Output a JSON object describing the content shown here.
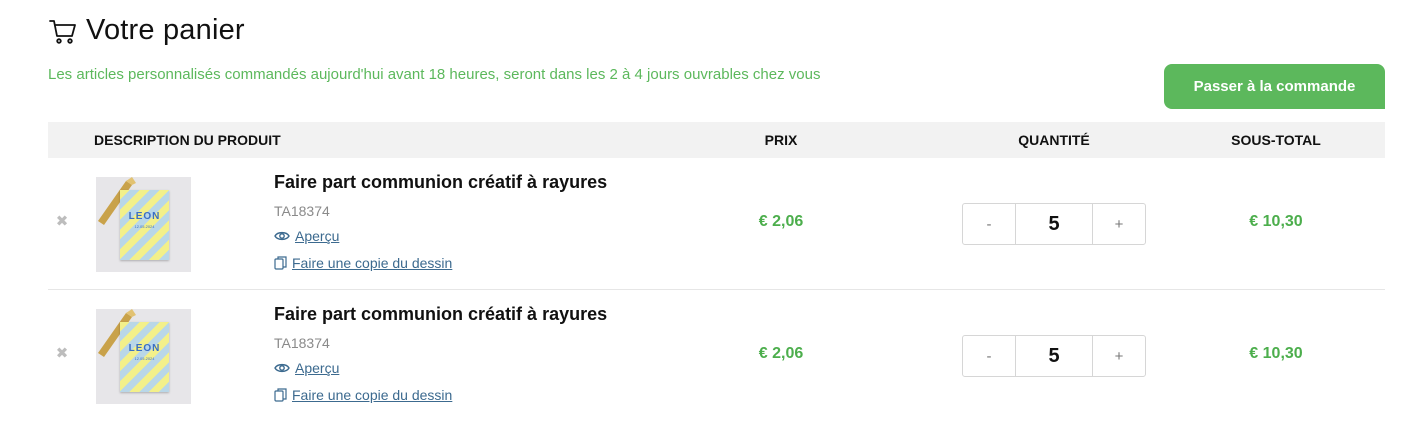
{
  "header": {
    "title": "Votre panier",
    "notice": "Les articles personnalisés commandés aujourd'hui avant 18 heures, seront dans les 2 à 4 jours ouvrables chez vous",
    "checkout_label": "Passer à la commande"
  },
  "table": {
    "columns": {
      "description": "DESCRIPTION DU PRODUIT",
      "price": "PRIX",
      "quantity": "QUANTITÉ",
      "subtotal": "SOUS-TOTAL"
    },
    "rows": [
      {
        "remove_symbol": "✖",
        "name": "Faire part communion créatif à rayures",
        "sku": "TA18374",
        "preview_label": "Aperçu",
        "copy_label": "Faire une copie du dessin",
        "thumb_name": "LEON",
        "thumb_date": "12.05.2024",
        "price": "€ 2,06",
        "minus": "-",
        "quantity": "5",
        "plus": "+",
        "subtotal": "€ 10,30"
      },
      {
        "remove_symbol": "✖",
        "name": "Faire part communion créatif à rayures",
        "sku": "TA18374",
        "preview_label": "Aperçu",
        "copy_label": "Faire une copie du dessin",
        "thumb_name": "LEON",
        "thumb_date": "12.05.2024",
        "price": "€ 2,06",
        "minus": "-",
        "quantity": "5",
        "plus": "+",
        "subtotal": "€ 10,30"
      }
    ]
  },
  "colors": {
    "accent": "#5cb85c",
    "price_green": "#4cae4c",
    "link_blue": "#3c6a8f",
    "header_bg": "#f2f2f2"
  },
  "icons": [
    "cart-icon",
    "remove-icon",
    "eye-icon",
    "copy-icon"
  ]
}
